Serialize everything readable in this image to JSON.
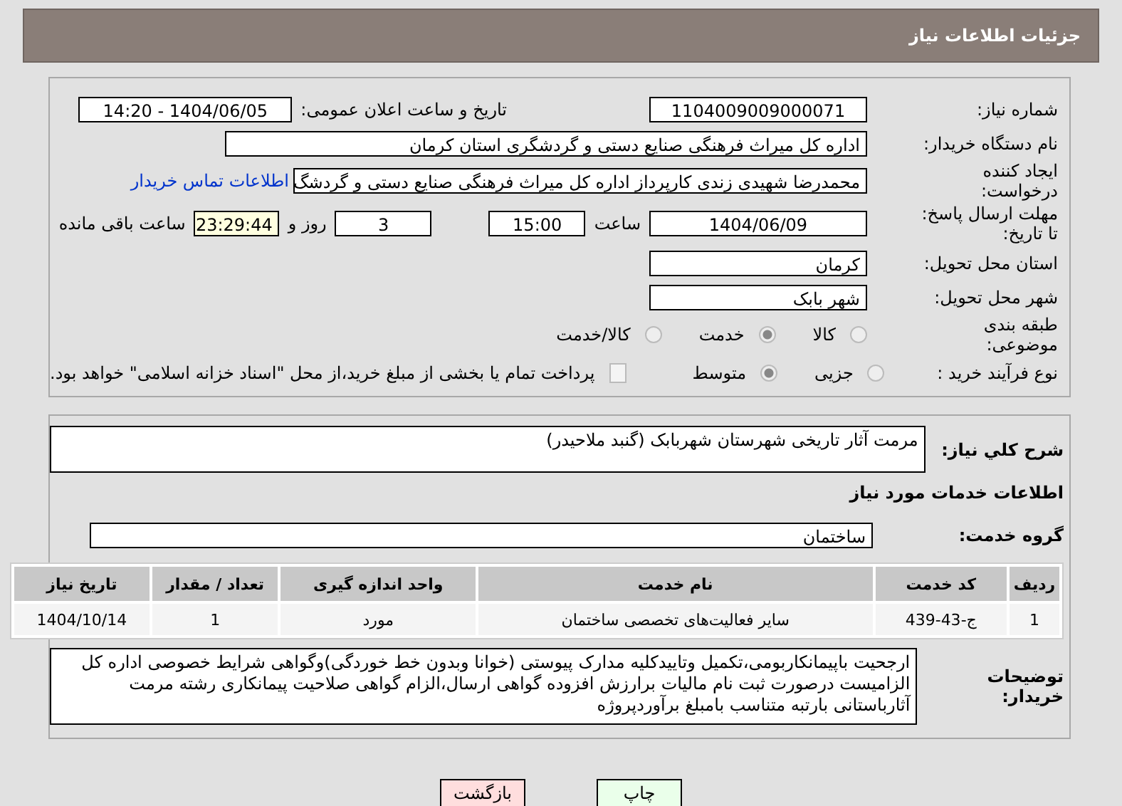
{
  "header": {
    "title": "جزئیات اطلاعات نیاز"
  },
  "need_number": {
    "label": "شماره نیاز:",
    "value": "1104009009000071"
  },
  "announce": {
    "label": "تاریخ و ساعت اعلان عمومی:",
    "value": "1404/06/05 - 14:20"
  },
  "buyer": {
    "label": "نام دستگاه خریدار:",
    "value": "اداره کل میراث فرهنگی  صنایع دستی و گردشگری استان کرمان"
  },
  "creator": {
    "label": "ایجاد کننده درخواست:",
    "value": "محمدرضا شهیدی زندی کارپرداز اداره کل میراث فرهنگی  صنایع دستی و گردشگ",
    "link": "اطلاعات تماس خریدار"
  },
  "deadline": {
    "label": "مهلت ارسال پاسخ: تا تاریخ:",
    "date": "1404/06/09",
    "time_label": "ساعت",
    "time": "15:00",
    "days": "3",
    "days_label": "روز و",
    "remaining": "23:29:44",
    "remaining_label": "ساعت باقی مانده"
  },
  "province": {
    "label": "استان محل تحویل:",
    "value": "کرمان"
  },
  "city": {
    "label": "شهر محل تحویل:",
    "value": "شهر بابک"
  },
  "category": {
    "label": "طبقه بندی موضوعی:",
    "options": [
      {
        "label": "کالا",
        "selected": false
      },
      {
        "label": "خدمت",
        "selected": true
      },
      {
        "label": "کالا/خدمت",
        "selected": false
      }
    ]
  },
  "process": {
    "label": "نوع فرآیند خرید :",
    "options": [
      {
        "label": "جزیی",
        "selected": false
      },
      {
        "label": "متوسط",
        "selected": true
      }
    ],
    "payment": {
      "label": "پرداخت تمام یا بخشی از مبلغ خرید،از محل \"اسناد خزانه اسلامی\" خواهد بود.",
      "checked": false
    }
  },
  "summary": {
    "label": "شرح کلي نياز:",
    "value": "مرمت آثار تاریخی شهرستان شهربابک (گنبد ملاحیدر)"
  },
  "services_title": "اطلاعات خدمات مورد نیاز",
  "service_group": {
    "label": "گروه خدمت:",
    "value": "ساختمان"
  },
  "table": {
    "columns": [
      "ردیف",
      "کد خدمت",
      "نام خدمت",
      "واحد اندازه گیری",
      "تعداد / مقدار",
      "تاریخ نیاز"
    ],
    "rows": [
      [
        "1",
        "ج-43-439",
        "سایر فعالیت‌های تخصصی ساختمان",
        "مورد",
        "1",
        "1404/10/14"
      ]
    ]
  },
  "buyer_notes": {
    "label": "توضیحات خریدار:",
    "value": "ارجحیت باپیمانکاربومی،تکمیل وتاییدکلیه مدارک پیوستی (خوانا وبدون خط خوردگی)وگواهی شرایط خصوصی اداره کل الزامیست درصورت ثبت نام مالیات برارزش افزوده گواهی ارسال،الزام گواهی صلاحیت پیمانکاری رشته مرمت آثارباستانی بارتبه متناسب بامبلغ برآوردپروژه"
  },
  "buttons": [
    {
      "label": "چاپ",
      "kind": "print"
    },
    {
      "label": "بازگشت",
      "kind": "back"
    }
  ]
}
